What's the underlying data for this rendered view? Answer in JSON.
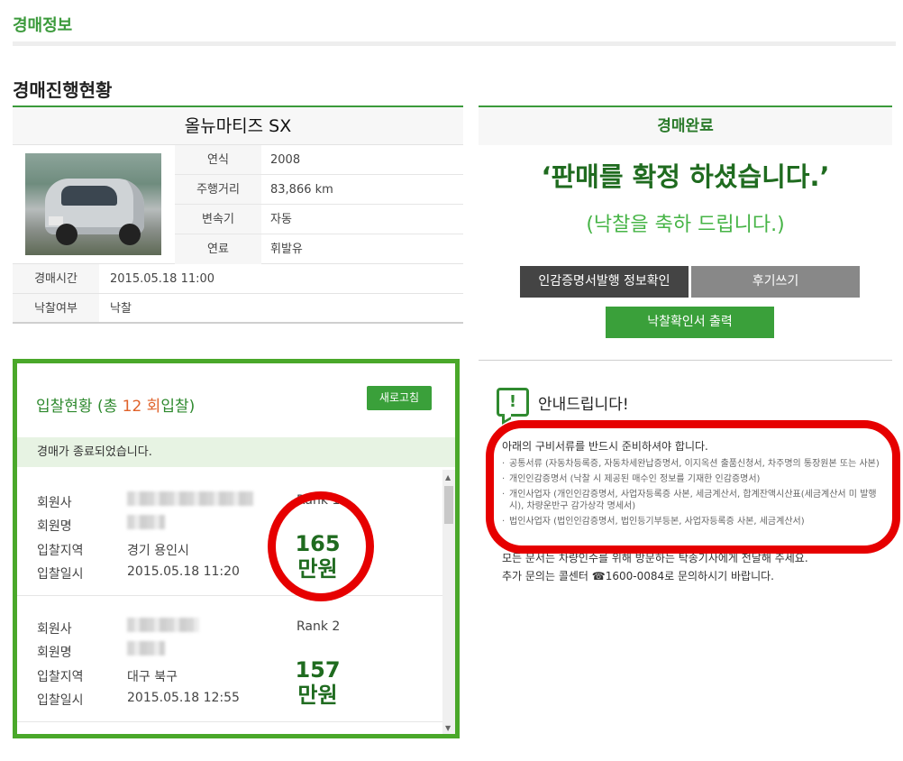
{
  "page": {
    "title": "경매정보",
    "section_title": "경매진행현황"
  },
  "car": {
    "name": "올뉴마티즈 SX",
    "photo_alt": "차량 사진",
    "specs": [
      {
        "label": "연식",
        "value": "2008"
      },
      {
        "label": "주행거리",
        "value": "83,866 km"
      },
      {
        "label": "변속기",
        "value": "자동"
      },
      {
        "label": "연료",
        "value": "휘발유"
      }
    ],
    "info": [
      {
        "label": "경매시간",
        "value": "2015.05.18 11:00"
      },
      {
        "label": "낙찰여부",
        "value": "낙찰"
      }
    ]
  },
  "complete": {
    "heading": "경매완료",
    "message": "‘판매를 확정 하셨습니다.’",
    "congrats": "(낙찰을 축하 드립니다.)",
    "btn_cert": "인감증명서발행 정보확인",
    "btn_review": "후기쓰기",
    "btn_print": "낙찰확인서 출력"
  },
  "bids": {
    "title_prefix": "입찰현황 (총 ",
    "count": "12 회",
    "title_suffix": "입찰)",
    "refresh_label": "새로고침",
    "notice": "경매가 종료되었습니다.",
    "field_labels": {
      "member_company": "회원사",
      "member_name": "회원명",
      "region": "입찰지역",
      "datetime": "입찰일시"
    },
    "items": [
      {
        "rank": "Rank 1",
        "region": "경기 용인시",
        "datetime": "2015.05.18 11:20",
        "amount": "165",
        "unit": "만원"
      },
      {
        "rank": "Rank 2",
        "region": "대구 북구",
        "datetime": "2015.05.18 12:55",
        "amount": "157",
        "unit": "만원"
      }
    ]
  },
  "notice": {
    "title": "안내드립니다!",
    "lead": "아래의 구비서류를 반드시 준비하셔야 합니다.",
    "items": [
      "공통서류 (자동차등록증, 자동차세완납증명서, 이지옥션 출품신청서, 차주명의 통장원본 또는 사본)",
      "개인인감증명서 (낙찰 시 제공된 매수인 정보를 기재한 인감증명서)",
      "개인사업자 (개인인감증명서, 사업자등록증 사본, 세금계산서, 합계잔액시산표(세금계산서 미 발행 시), 차량운반구 감가상각 명세서)",
      "법인사업자 (법인인감증명서, 법인등기부등본, 사업자등록증 사본, 세금계산서)"
    ],
    "foot1": "모든 문서는 차량인수를 위해 방문하는 탁송기사에게 전달해 주세요.",
    "foot2": "추가 문의는 콜센터 ☎1600-0084로 문의하시기 바랍니다."
  }
}
